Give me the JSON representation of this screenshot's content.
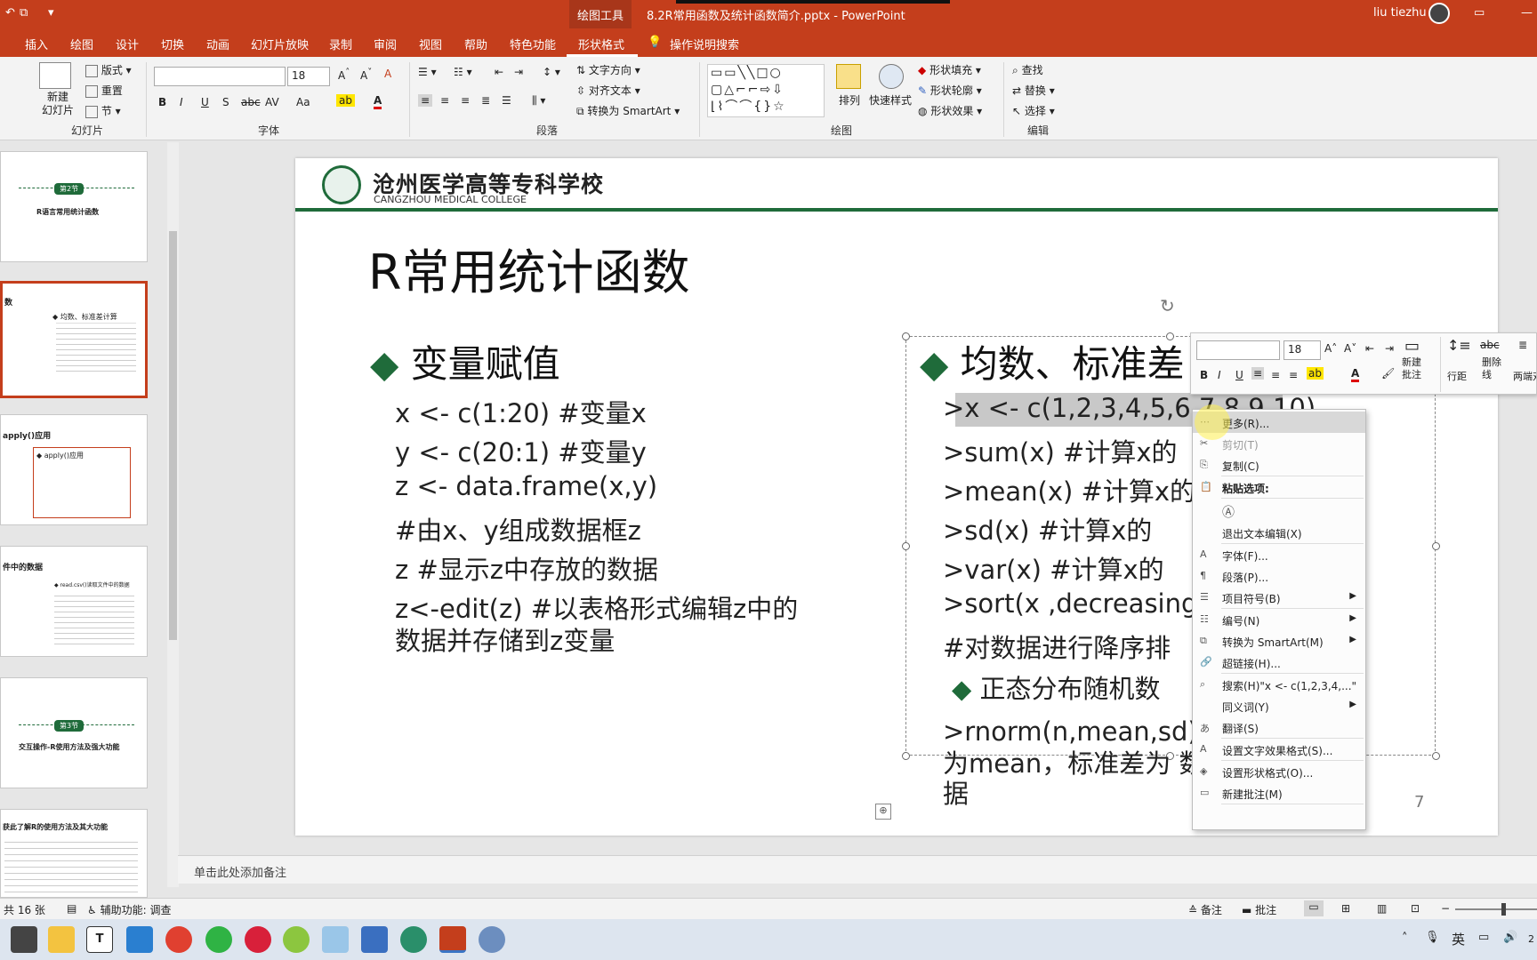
{
  "titlebar": {
    "context_tab": "绘图工具",
    "doc_title": "8.2R常用函数及统计函数简介.pptx  -  PowerPoint",
    "user": "liu tiezhu"
  },
  "tabs": [
    "插入",
    "绘图",
    "设计",
    "切换",
    "动画",
    "幻灯片放映",
    "录制",
    "审阅",
    "视图",
    "帮助",
    "特色功能",
    "形状格式"
  ],
  "tell_me": "操作说明搜索",
  "ribbon": {
    "slides_group": {
      "new_slide": "新建\n幻灯片",
      "layout": "版式",
      "reset": "重置",
      "section": "节",
      "label": "幻灯片"
    },
    "font_group": {
      "font_name": "",
      "font_size": "18",
      "label": "字体",
      "bold": "B",
      "italic": "I",
      "underline": "U",
      "shadow": "S",
      "strike": "abc",
      "spacing": "AV",
      "case": "Aa"
    },
    "para_group": {
      "text_dir": "文字方向",
      "align_text": "对齐文本",
      "smartart": "转换为 SmartArt",
      "label": "段落"
    },
    "draw_group": {
      "arrange": "排列",
      "quick_styles": "快速样式",
      "fill": "形状填充",
      "outline": "形状轮廓",
      "effects": "形状效果",
      "label": "绘图"
    },
    "edit_group": {
      "find": "查找",
      "replace": "替换",
      "select": "选择",
      "label": "编辑"
    }
  },
  "thumbs": [
    {
      "title": "R语言常用统计函数",
      "badge": "第2节"
    },
    {
      "title": "数",
      "line1": "◆ 均数、标准差计算"
    },
    {
      "title": "apply()应用",
      "line1": "◆ apply()应用"
    },
    {
      "title": "件中的数据",
      "line1": "◆ read.csv()读取文件中的数据"
    },
    {
      "title": "交互操作-R使用方法及强大功能",
      "badge": "第3节"
    },
    {
      "title": "获此了解R的使用方法及其大功能"
    }
  ],
  "slide": {
    "college_cn": "沧州医学高等专科学校",
    "college_en": "CANGZHOU  MEDICAL  COLLEGE",
    "title": "R常用统计函数",
    "left": {
      "heading": "变量赋值",
      "lines": [
        "x <- c(1:20)          #变量x",
        "y <- c(20:1)          #变量y",
        "z <- data.frame(x,y)",
        "     #由x、y组成数据框z",
        "z     #显示z中存放的数据",
        "z<-edit(z)     #以表格形式编辑z中的",
        "数据并存储到z变量"
      ]
    },
    "right": {
      "heading": "均数、标准差",
      "lines": [
        ">x <- c(1,2,3,4,5,6,7,8,9,10)",
        ">sum(x)     #计算x的",
        ">mean(x)    #计算x的",
        ">sd(x)      #计算x的",
        ">var(x)     #计算x的",
        ">sort(x ,decreasing=T",
        "#对数据进行降序排"
      ],
      "sub_heading": "正态分布随机数",
      "rnorm": [
        ">rnorm(n,mean,sd)            均数",
        "为mean，标准差为            数",
        "据"
      ]
    },
    "page_num": "7"
  },
  "minibar": {
    "font_size": "18",
    "new_comment": "新建\n批注",
    "line_spacing": "行距",
    "strikethrough": "删除\n线",
    "more": "两端对"
  },
  "context_menu": [
    {
      "label": "更多(R)...",
      "icon": "more-icon",
      "highlight": true
    },
    {
      "label": "剪切(T)",
      "icon": "scissors-icon",
      "disabled": true
    },
    {
      "label": "复制(C)",
      "icon": "copy-icon"
    },
    {
      "label": "粘贴选项:",
      "icon": "paste-icon",
      "header": true
    },
    {
      "label": "",
      "icon": "paste-text-icon",
      "paste_row": true
    },
    {
      "label": "退出文本编辑(X)",
      "icon": ""
    },
    {
      "label": "字体(F)...",
      "icon": "font-icon"
    },
    {
      "label": "段落(P)...",
      "icon": "paragraph-icon"
    },
    {
      "label": "项目符号(B)",
      "icon": "bullets-icon",
      "submenu": true
    },
    {
      "label": "编号(N)",
      "icon": "numbering-icon",
      "submenu": true
    },
    {
      "label": "转换为 SmartArt(M)",
      "icon": "smartart-icon",
      "submenu": true
    },
    {
      "label": "超链接(H)...",
      "icon": "link-icon"
    },
    {
      "label": "搜索(H)\"x <- c(1,2,3,4,...\"",
      "icon": "search-icon"
    },
    {
      "label": "同义词(Y)",
      "icon": "",
      "submenu": true
    },
    {
      "label": "翻译(S)",
      "icon": "translate-icon"
    },
    {
      "label": "设置文字效果格式(S)...",
      "icon": "text-effect-icon"
    },
    {
      "label": "设置形状格式(O)...",
      "icon": "shape-format-icon"
    },
    {
      "label": "新建批注(M)",
      "icon": "comment-icon"
    }
  ],
  "notes_placeholder": "单击此处添加备注",
  "status": {
    "slide_count": "共 16 张",
    "accessibility": "辅助功能: 调查",
    "notes": "备注",
    "comments": "批注"
  },
  "taskbar": {
    "ime": "英",
    "clock": "2"
  },
  "colors": {
    "accent": "#c43e1c",
    "brand_green": "#1f6b3a"
  }
}
